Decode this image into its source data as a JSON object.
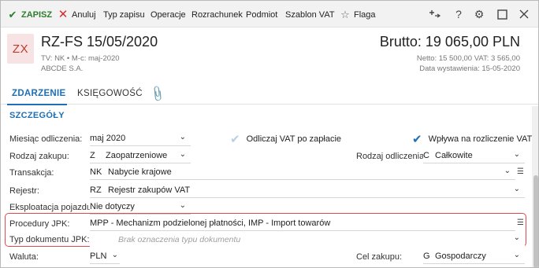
{
  "toolbar": {
    "save": "ZAPISZ",
    "cancel": "Anuluj",
    "type": "Typ zapisu",
    "ops": "Operacje",
    "settlement": "Rozrachunek",
    "entity": "Podmiot",
    "vat_template": "Szablon VAT",
    "flag": "Flaga"
  },
  "header": {
    "badge": "ZX",
    "title": "RZ-FS 15/05/2020",
    "sub": "TV: NK  •  M-c: maj-2020",
    "company": "ABCDE S.A.",
    "brutto": "Brutto: 19 065,00 PLN",
    "netto": "Netto: 15 500,00 VAT: 3 565,00",
    "date": "Data wystawienia: 15-05-2020"
  },
  "tabs": [
    "ZDARZENIE",
    "KSIĘGOWOŚĆ"
  ],
  "section_title": "SZCZEGÓŁY",
  "form": {
    "miesiac_label": "Miesiąc odliczenia:",
    "miesiac_value": "maj 2020",
    "odliczaj_label": "Odliczaj VAT po zapłacie",
    "wplywa_label": "Wpływa na rozliczenie VAT",
    "rodzaj_zakupu_label": "Rodzaj zakupu:",
    "rodzaj_zakupu_code": "Z",
    "rodzaj_zakupu_value": "Zaopatrzeniowe",
    "rodzaj_odliczenia_label": "Rodzaj odliczenia:",
    "rodzaj_odliczenia_code": "C",
    "rodzaj_odliczenia_value": "Całkowite",
    "transakcja_label": "Transakcja:",
    "transakcja_code": "NK",
    "transakcja_value": "Nabycie krajowe",
    "rejestr_label": "Rejestr:",
    "rejestr_code": "RZ",
    "rejestr_value": "Rejestr zakupów VAT",
    "eksploatacja_label": "Eksploatacja pojazdu:",
    "eksploatacja_value": "Nie dotyczy",
    "procedury_label": "Procedury JPK:",
    "procedury_value": "MPP - Mechanizm podzielonej płatności, IMP - Import towarów",
    "typ_dok_label": "Typ dokumentu JPK:",
    "typ_dok_placeholder": "Brak oznaczenia typu dokumentu",
    "waluta_label": "Waluta:",
    "waluta_value": "PLN",
    "cel_label": "Cel zakupu:",
    "cel_code": "G",
    "cel_value": "Gospodarczy"
  },
  "colors": {
    "accent": "#1e6fb5",
    "save_green": "#2d7d2d",
    "cancel_red": "#d62b2b",
    "badge_bg": "#f7e3e3",
    "badge_text": "#c0392b",
    "highlight": "#e04a4a"
  }
}
